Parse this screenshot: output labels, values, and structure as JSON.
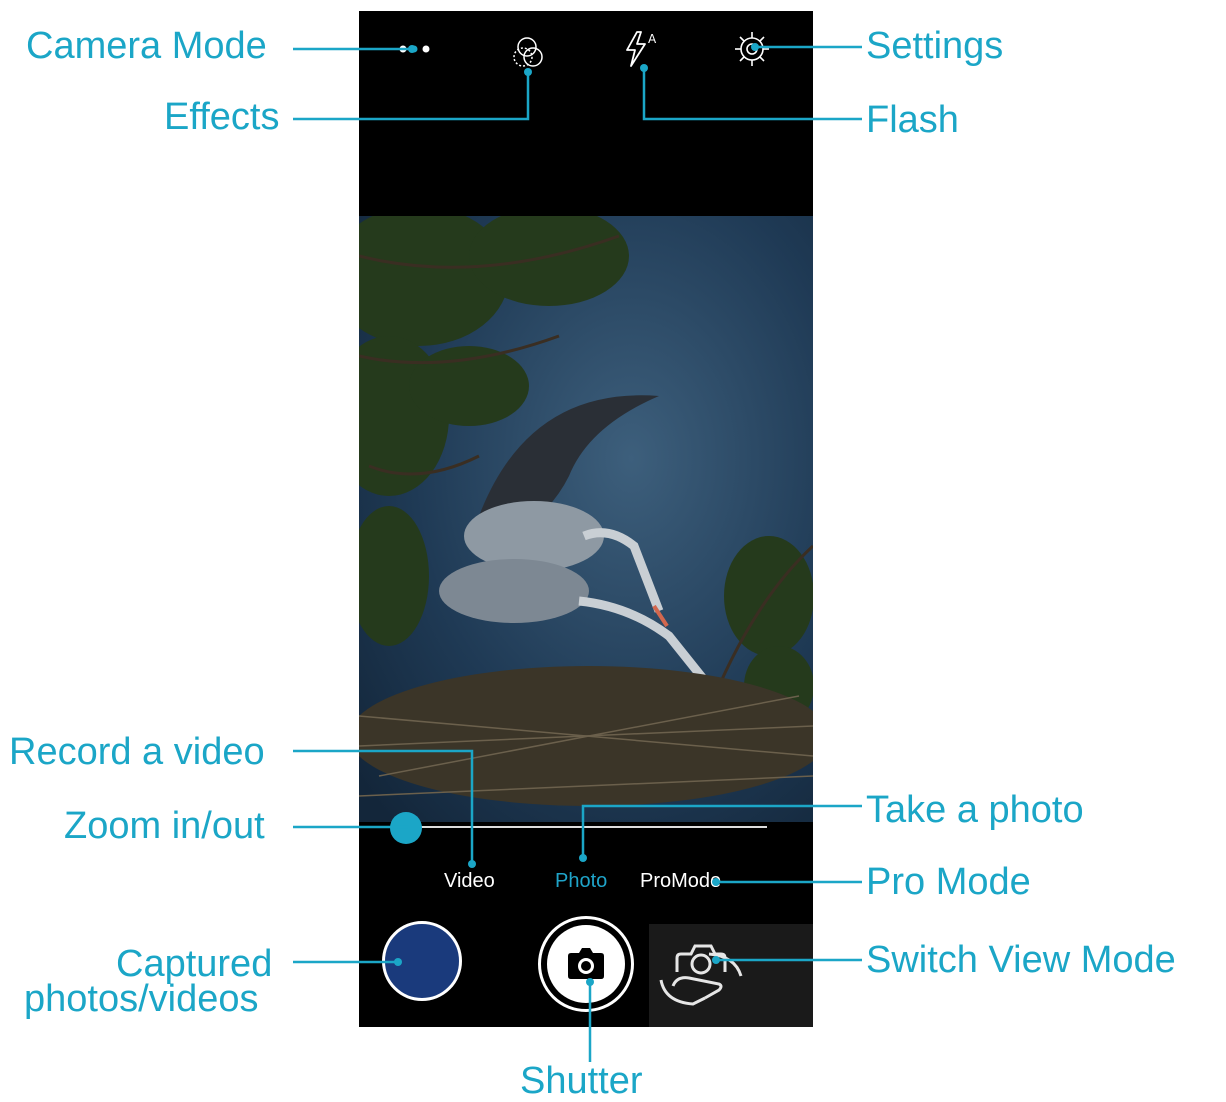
{
  "colors": {
    "accent": "#1ba6c7",
    "phone_bg": "#000000",
    "gallery_thumb": "#1a3a7c"
  },
  "top_bar": {
    "icons": [
      "camera-mode-icon",
      "effects-icon",
      "flash-auto-icon",
      "settings-icon"
    ]
  },
  "modes": {
    "items": [
      {
        "label": "Video"
      },
      {
        "label": "Photo",
        "active": true
      },
      {
        "label": "ProMode"
      }
    ]
  },
  "zoom": {
    "level": 0
  },
  "bottom_bar": {
    "icons": [
      "gallery-thumbnail",
      "shutter-camera-icon",
      "switch-camera-icon"
    ]
  },
  "callouts": {
    "camera_mode": "Camera Mode",
    "effects": "Effects",
    "settings": "Settings",
    "flash": "Flash",
    "record_video": "Record a video",
    "zoom": "Zoom in/out",
    "take_photo": "Take a photo",
    "pro_mode": "Pro Mode",
    "captured_line1": "Captured",
    "captured_line2": "photos/videos",
    "switch_view": "Switch View Mode",
    "shutter": "Shutter"
  }
}
